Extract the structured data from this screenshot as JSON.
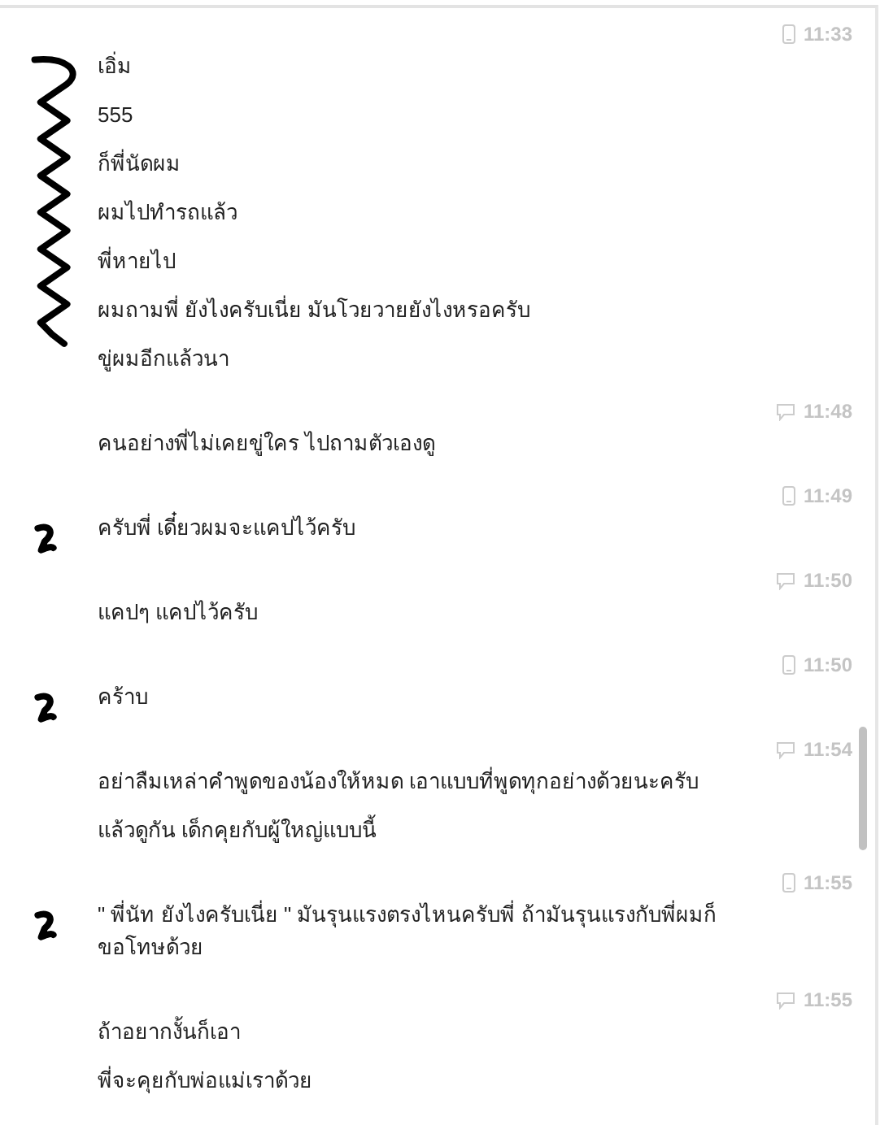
{
  "groups": [
    {
      "time": "11:33",
      "kind": "mobile",
      "scribbled": true,
      "messages": [
        "เอิ่ม",
        "555",
        "ก็พี่นัดผม",
        "ผมไปทำรถแล้ว",
        "พี่หายไป",
        "ผมถามพี่ ยังไงครับเนี่ย มันโวยวายยังไงหรอครับ",
        "ขู่ผมอีกแล้วนา"
      ]
    },
    {
      "time": "11:48",
      "kind": "web",
      "scribbled": false,
      "messages": [
        "คนอย่างพี่ไม่เคยขู่ใคร ไปถามตัวเองดู"
      ]
    },
    {
      "time": "11:49",
      "kind": "mobile",
      "scribbled": true,
      "messages": [
        "ครับพี่ เดี๋ยวผมจะแคปไว้ครับ"
      ]
    },
    {
      "time": "11:50",
      "kind": "web",
      "scribbled": false,
      "messages": [
        "แคปๆ แคปไว้ครับ"
      ]
    },
    {
      "time": "11:50",
      "kind": "mobile",
      "scribbled": true,
      "messages": [
        "คร้าบ"
      ]
    },
    {
      "time": "11:54",
      "kind": "web",
      "scribbled": false,
      "messages": [
        "อย่าลืมเหล่าคำพูดของน้องให้หมด เอาแบบที่พูดทุกอย่างด้วยนะครับ",
        "แล้วดูกัน เด็กคุยกับผู้ใหญ่แบบนี้"
      ]
    },
    {
      "time": "11:55",
      "kind": "mobile",
      "scribbled": true,
      "messages": [
        "\" พี่นัท ยังไงครับเนี่ย \" มันรุนแรงตรงไหนครับพี่ ถ้ามันรุนแรงกับพี่ผมก็ขอโทษด้วย"
      ]
    },
    {
      "time": "11:55",
      "kind": "web",
      "scribbled": false,
      "messages": [
        "ถ้าอยากงั้นก็เอา",
        "พี่จะคุยกับพ่อแม่เราด้วย"
      ]
    }
  ]
}
